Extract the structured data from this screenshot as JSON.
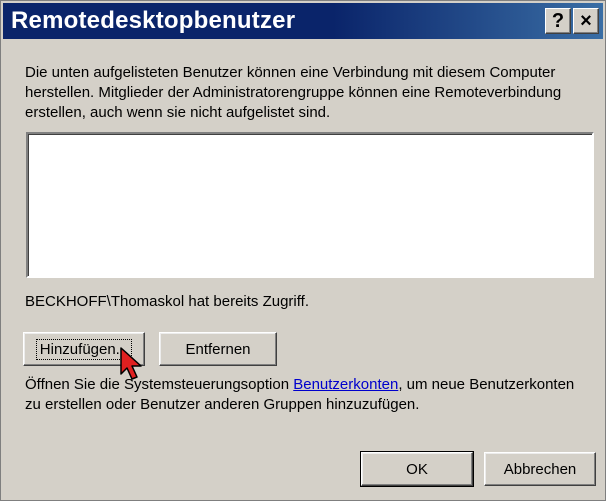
{
  "window": {
    "title": "Remotedesktopbenutzer",
    "help_glyph": "?",
    "close_glyph": "×"
  },
  "description": "Die unten aufgelisteten Benutzer können eine Verbindung mit diesem Computer herstellen. Mitglieder der Administratorengruppe können eine Remoteverbindung erstellen, auch wenn sie nicht aufgelistet sind.",
  "users_list": [],
  "access_status": "BECKHOFF\\Thomaskol hat bereits Zugriff.",
  "buttons": {
    "add": "Hinzufügen...",
    "remove": "Entfernen",
    "ok": "OK",
    "cancel": "Abbrechen"
  },
  "info": {
    "before_link": "Öffnen Sie die Systemsteuerungsoption ",
    "link": "Benutzerkonten",
    "after_link": ", um neue Benutzerkonten zu erstellen oder Benutzer anderen Gruppen hinzuzufügen."
  },
  "colors": {
    "titlebar": "#0a246a",
    "dialog_bg": "#d4d0c8",
    "link": "#0000cc",
    "cursor": "#e02020"
  },
  "icons": [
    "help-icon",
    "close-icon",
    "mouse-pointer-icon"
  ]
}
